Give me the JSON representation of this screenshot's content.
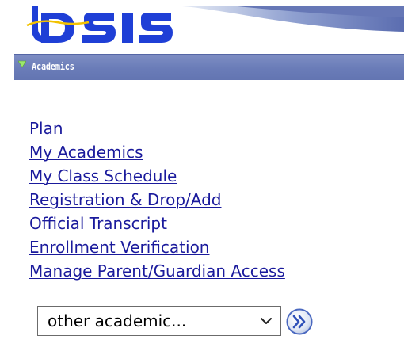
{
  "header": {
    "logo_text": "UDSIS"
  },
  "section": {
    "title": "Academics"
  },
  "links": [
    {
      "label": "Plan"
    },
    {
      "label": "My Academics"
    },
    {
      "label": "My Class Schedule"
    },
    {
      "label": "Registration & Drop/Add"
    },
    {
      "label": "Official Transcript"
    },
    {
      "label": "Enrollment Verification"
    },
    {
      "label": "Manage Parent/Guardian Access"
    }
  ],
  "dropdown": {
    "selected": "other academic...",
    "icon": "chevron-down-icon"
  },
  "go_button": {
    "icon": "double-chevron-right-icon"
  },
  "colors": {
    "section_bar": "#6a7cb8",
    "link": "#1a1a9c",
    "logo_blue": "#1f3fd6",
    "toggle_green": "#9be86b"
  }
}
